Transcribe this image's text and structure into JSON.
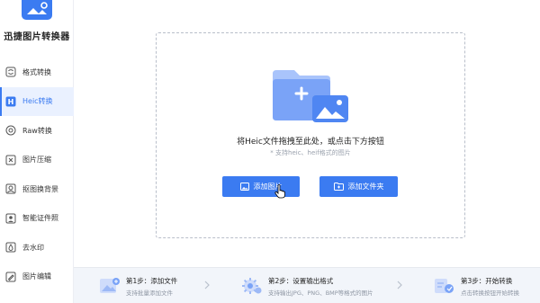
{
  "app": {
    "title": "迅捷图片转换器"
  },
  "sidebar": {
    "items": [
      {
        "label": "格式转换",
        "icon": "refresh-icon",
        "active": false
      },
      {
        "label": "Heic转换",
        "icon": "heic-icon",
        "active": true
      },
      {
        "label": "Raw转换",
        "icon": "raw-icon",
        "active": false
      },
      {
        "label": "图片压缩",
        "icon": "compress-icon",
        "active": false
      },
      {
        "label": "抠图换背景",
        "icon": "cutout-icon",
        "active": false
      },
      {
        "label": "智能证件照",
        "icon": "id-photo-icon",
        "active": false
      },
      {
        "label": "去水印",
        "icon": "watermark-icon",
        "active": false
      },
      {
        "label": "图片编辑",
        "icon": "edit-image-icon",
        "active": false
      }
    ]
  },
  "dropzone": {
    "title": "将Heic文件拖拽至此处，或点击下方按钮",
    "subtitle": "* 支持heic、heif格式的图片",
    "add_image_label": "添加图片",
    "add_folder_label": "添加文件夹"
  },
  "steps": [
    {
      "title": "第1步：添加文件",
      "desc": "支持批量添加文件"
    },
    {
      "title": "第2步：设置输出格式",
      "desc": "支持输出JPG、PNG、BMP等格式的图片"
    },
    {
      "title": "第3步：开始转换",
      "desc": "点击转换按钮开始转换"
    }
  ],
  "colors": {
    "accent": "#3b7bf1",
    "sidebar_active_bg": "#eaf1ff"
  }
}
